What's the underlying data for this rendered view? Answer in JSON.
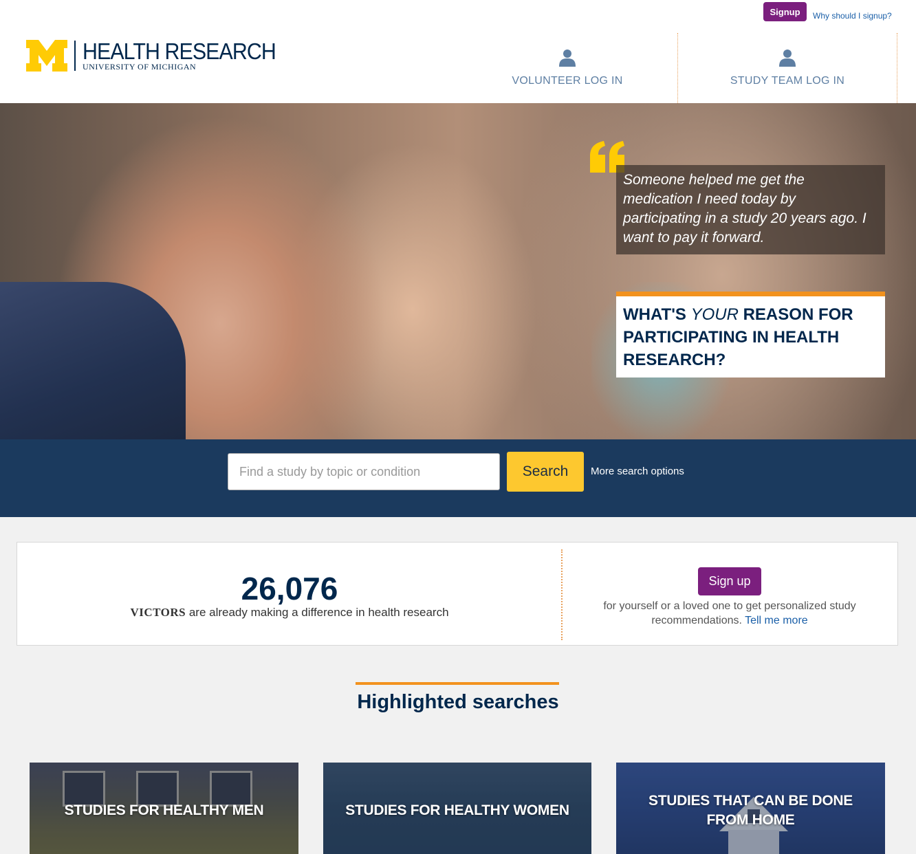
{
  "header": {
    "signup_label": "Signup",
    "why_link": "Why should I signup?",
    "logo_letter": "M",
    "logo_title": "HEALTH RESEARCH",
    "logo_subtitle": "UNIVERSITY OF MICHIGAN",
    "volunteer_login": "VOLUNTEER LOG IN",
    "team_login": "STUDY TEAM LOG IN",
    "icons": {
      "volunteer": "user-icon",
      "team": "user-icon"
    }
  },
  "hero": {
    "quote": "Someone helped me get the medication I need today by participating in a study 20 years ago. I want to pay it forward.",
    "reason_before": "WHAT'S ",
    "reason_emph": "YOUR",
    "reason_after": " REASON FOR PARTICIPATING IN HEALTH RESEARCH?"
  },
  "search": {
    "placeholder": "Find a study by topic or condition",
    "button": "Search",
    "more_options": "More search options"
  },
  "stats": {
    "count": "26,076",
    "victors": "VICTORS",
    "caption": " are already making a difference in health research",
    "signup_button": "Sign up",
    "signup_text": "for yourself or a loved one to get personalized study recommendations.",
    "tell_more": "Tell me more"
  },
  "highlighted": {
    "title": "Highlighted searches",
    "tiles": [
      {
        "label": "STUDIES FOR HEALTHY MEN"
      },
      {
        "label": "STUDIES FOR HEALTHY WOMEN"
      },
      {
        "label": "STUDIES THAT CAN BE DONE FROM HOME"
      }
    ]
  },
  "colors": {
    "maize": "#ffcb05",
    "blue": "#00274c",
    "purple": "#7b1f7e",
    "orange": "#f2921e",
    "search_band": "#1b3a5e"
  }
}
